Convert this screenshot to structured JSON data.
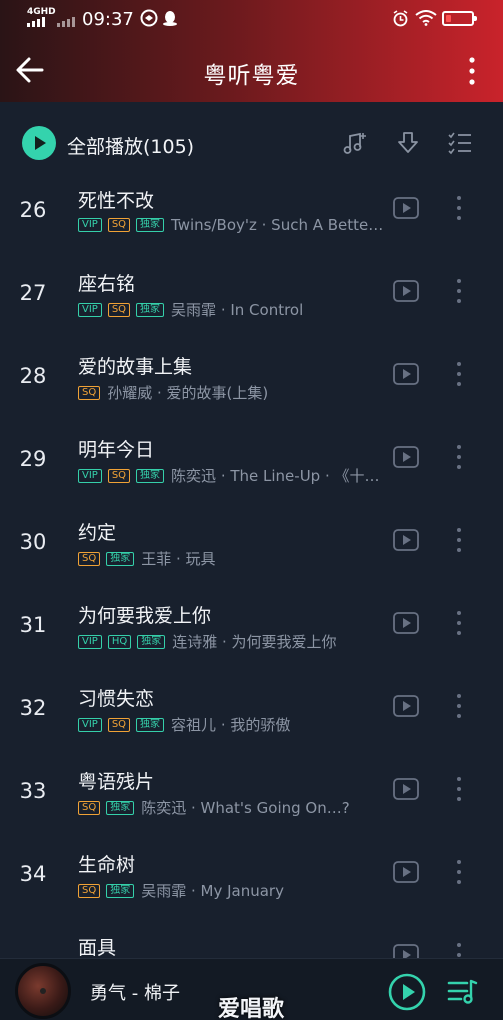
{
  "status_bar": {
    "network": "4GHD",
    "time": "09:37",
    "battery_level": 0.2,
    "battery_color": "#ff5252"
  },
  "header": {
    "back_icon": "back-arrow-icon",
    "title": "粤听粤爱",
    "more_icon": "more-vertical-icon"
  },
  "toolbar": {
    "play_all_label": "全部播放(105)",
    "accent": "#34d3ad",
    "tools": [
      "music-add-icon",
      "download-icon",
      "multi-select-icon"
    ]
  },
  "songs": [
    {
      "index": "26",
      "title": "死性不改",
      "tags": [
        "VIP",
        "SQ",
        "独家"
      ],
      "meta": "Twins/Boy'z · Such A Bette…"
    },
    {
      "index": "27",
      "title": "座右铭",
      "tags": [
        "VIP",
        "SQ",
        "独家"
      ],
      "meta": "吴雨霏 · In Control"
    },
    {
      "index": "28",
      "title": "爱的故事上集",
      "tags": [
        "SQ"
      ],
      "meta": "孙耀威 · 爱的故事(上集)"
    },
    {
      "index": "29",
      "title": "明年今日",
      "tags": [
        "VIP",
        "SQ",
        "独家"
      ],
      "meta": "陈奕迅 · The Line-Up · 《十…"
    },
    {
      "index": "30",
      "title": "约定",
      "tags": [
        "SQ",
        "独家"
      ],
      "meta": "王菲 · 玩具"
    },
    {
      "index": "31",
      "title": "为何要我爱上你",
      "tags": [
        "VIP",
        "HQ",
        "独家"
      ],
      "meta": "连诗雅 · 为何要我爱上你"
    },
    {
      "index": "32",
      "title": "习惯失恋",
      "tags": [
        "VIP",
        "SQ",
        "独家"
      ],
      "meta": "容祖儿 · 我的骄傲"
    },
    {
      "index": "33",
      "title": "粤语残片",
      "tags": [
        "SQ",
        "独家"
      ],
      "meta": "陈奕迅 · What's Going On…?"
    },
    {
      "index": "34",
      "title": "生命树",
      "tags": [
        "SQ",
        "独家"
      ],
      "meta": "吴雨霏 · My January"
    },
    {
      "index": "",
      "title": "面具",
      "tags": [],
      "meta": ""
    }
  ],
  "player": {
    "now_playing": "勇气 - 棉子",
    "watermark": "爱唱歌"
  }
}
